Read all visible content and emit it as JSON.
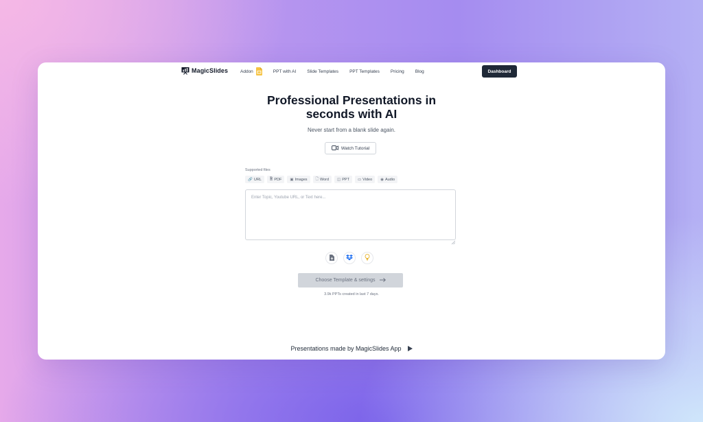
{
  "nav": {
    "logo_text": "MagicSlides",
    "links": [
      "Addon",
      "PPT with AI",
      "Slide Templates",
      "PPT Templates",
      "Pricing",
      "Blog"
    ],
    "dashboard_label": "Dashboard"
  },
  "hero": {
    "title_line1": "Professional Presentations in",
    "title_line2": "seconds with AI",
    "subtitle": "Never start from a blank slide again.",
    "tutorial_label": "Watch Tutorial"
  },
  "input": {
    "supported_label": "Supported files",
    "chips": [
      {
        "icon": "link-icon",
        "glyph": "🔗",
        "label": "URL"
      },
      {
        "icon": "pdf-icon",
        "glyph": "🗎",
        "label": "PDF"
      },
      {
        "icon": "image-icon",
        "glyph": "▣",
        "label": "Images"
      },
      {
        "icon": "word-icon",
        "glyph": "🗋",
        "label": "Word"
      },
      {
        "icon": "ppt-icon",
        "glyph": "◫",
        "label": "PPT"
      },
      {
        "icon": "video-icon",
        "glyph": "▭",
        "label": "Video"
      },
      {
        "icon": "audio-icon",
        "glyph": "◉",
        "label": "Audio"
      }
    ],
    "placeholder": "Enter Topic, Youtube URL, or Text here...",
    "value": ""
  },
  "actions": {
    "choose_label": "Choose Template & settings",
    "created_text": "3.9k PPTs created in last 7 days."
  },
  "footer": {
    "made_by": "Presentations made by MagicSlides App"
  },
  "colors": {
    "dashboard_bg": "#1f2937",
    "choose_bg": "#d1d5db",
    "addon_icon": "#f6c343",
    "dropbox_icon": "#1f6ff0",
    "bulb_icon": "#e7b125"
  }
}
